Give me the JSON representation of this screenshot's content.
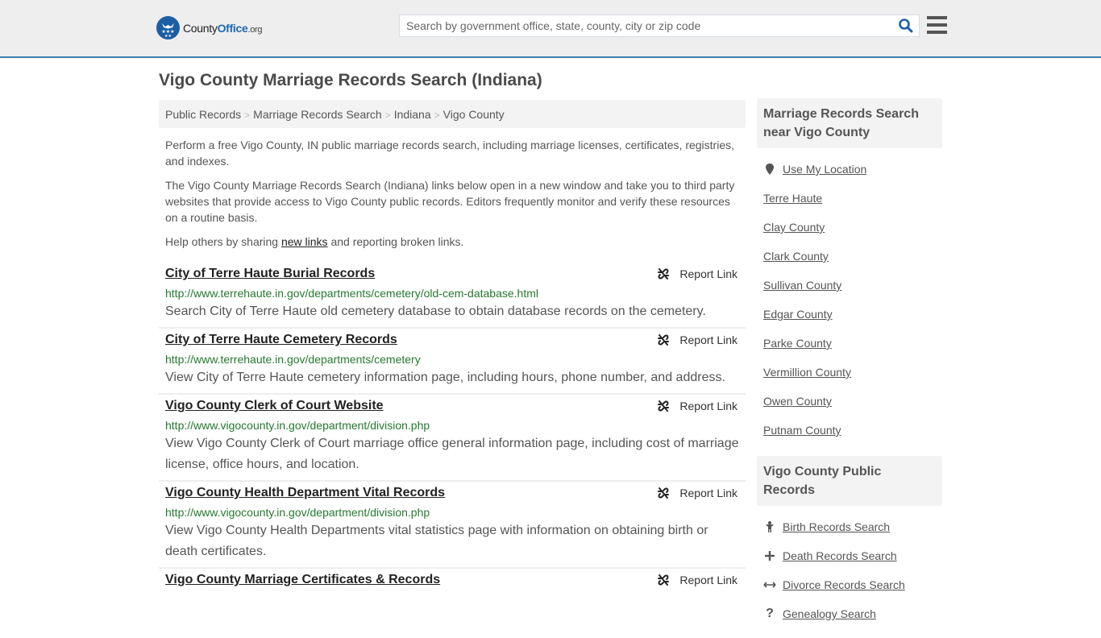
{
  "header": {
    "logo_county": "County",
    "logo_office": "Office",
    "logo_org": ".org",
    "search_placeholder": "Search by government office, state, county, city or zip code",
    "search_icon": "search-icon",
    "menu_icon": "hamburger-menu-icon"
  },
  "colors": {
    "brand_blue": "#1c67b3",
    "header_border": "#3a7cad",
    "url_green": "#257a2f",
    "header_bg": "#eeeeee"
  },
  "page_title": "Vigo County Marriage Records Search (Indiana)",
  "breadcrumb": [
    {
      "label": "Public Records"
    },
    {
      "label": "Marriage Records Search"
    },
    {
      "label": "Indiana"
    },
    {
      "label": "Vigo County"
    }
  ],
  "breadcrumb_separator": ">",
  "intro": {
    "p1": "Perform a free Vigo County, IN public marriage records search, including marriage licenses, certificates, registries, and indexes.",
    "p2": "The Vigo County Marriage Records Search (Indiana) links below open in a new window and take you to third party websites that provide access to Vigo County public records. Editors frequently monitor and verify these resources on a routine basis.",
    "p3_before": "Help others by sharing ",
    "p3_link": "new links",
    "p3_after": " and reporting broken links."
  },
  "results": [
    {
      "title": "City of Terre Haute Burial Records",
      "url": "http://www.terrehaute.in.gov/departments/cemetery/old-cem-database.html",
      "description": "Search City of Terre Haute old cemetery database to obtain database records on the cemetery.",
      "report_label": "Report Link"
    },
    {
      "title": "City of Terre Haute Cemetery Records",
      "url": "http://www.terrehaute.in.gov/departments/cemetery",
      "description": "View City of Terre Haute cemetery information page, including hours, phone number, and address.",
      "report_label": "Report Link"
    },
    {
      "title": "Vigo County Clerk of Court Website",
      "url": "http://www.vigocounty.in.gov/department/division.php",
      "description": "View Vigo County Clerk of Court marriage office general information page, including cost of marriage license, office hours, and location.",
      "report_label": "Report Link"
    },
    {
      "title": "Vigo County Health Department Vital Records",
      "url": "http://www.vigocounty.in.gov/department/division.php",
      "description": "View Vigo County Health Departments vital statistics page with information on obtaining birth or death certificates.",
      "report_label": "Report Link"
    },
    {
      "title": "Vigo County Marriage Certificates & Records",
      "url": "",
      "description": "",
      "report_label": "Report Link"
    }
  ],
  "sidebar": {
    "nearby": {
      "heading": "Marriage Records Search near Vigo County",
      "use_location": "Use My Location",
      "items": [
        "Terre Haute",
        "Clay County",
        "Clark County",
        "Sullivan County",
        "Edgar County",
        "Parke County",
        "Vermillion County",
        "Owen County",
        "Putnam County"
      ]
    },
    "public_records": {
      "heading": "Vigo County Public Records",
      "items": [
        {
          "label": "Birth Records Search",
          "icon": "child-icon"
        },
        {
          "label": "Death Records Search",
          "icon": "plus-icon"
        },
        {
          "label": "Divorce Records Search",
          "icon": "arrows-horizontal-icon"
        },
        {
          "label": "Genealogy Search",
          "icon": "question-icon"
        }
      ]
    }
  }
}
